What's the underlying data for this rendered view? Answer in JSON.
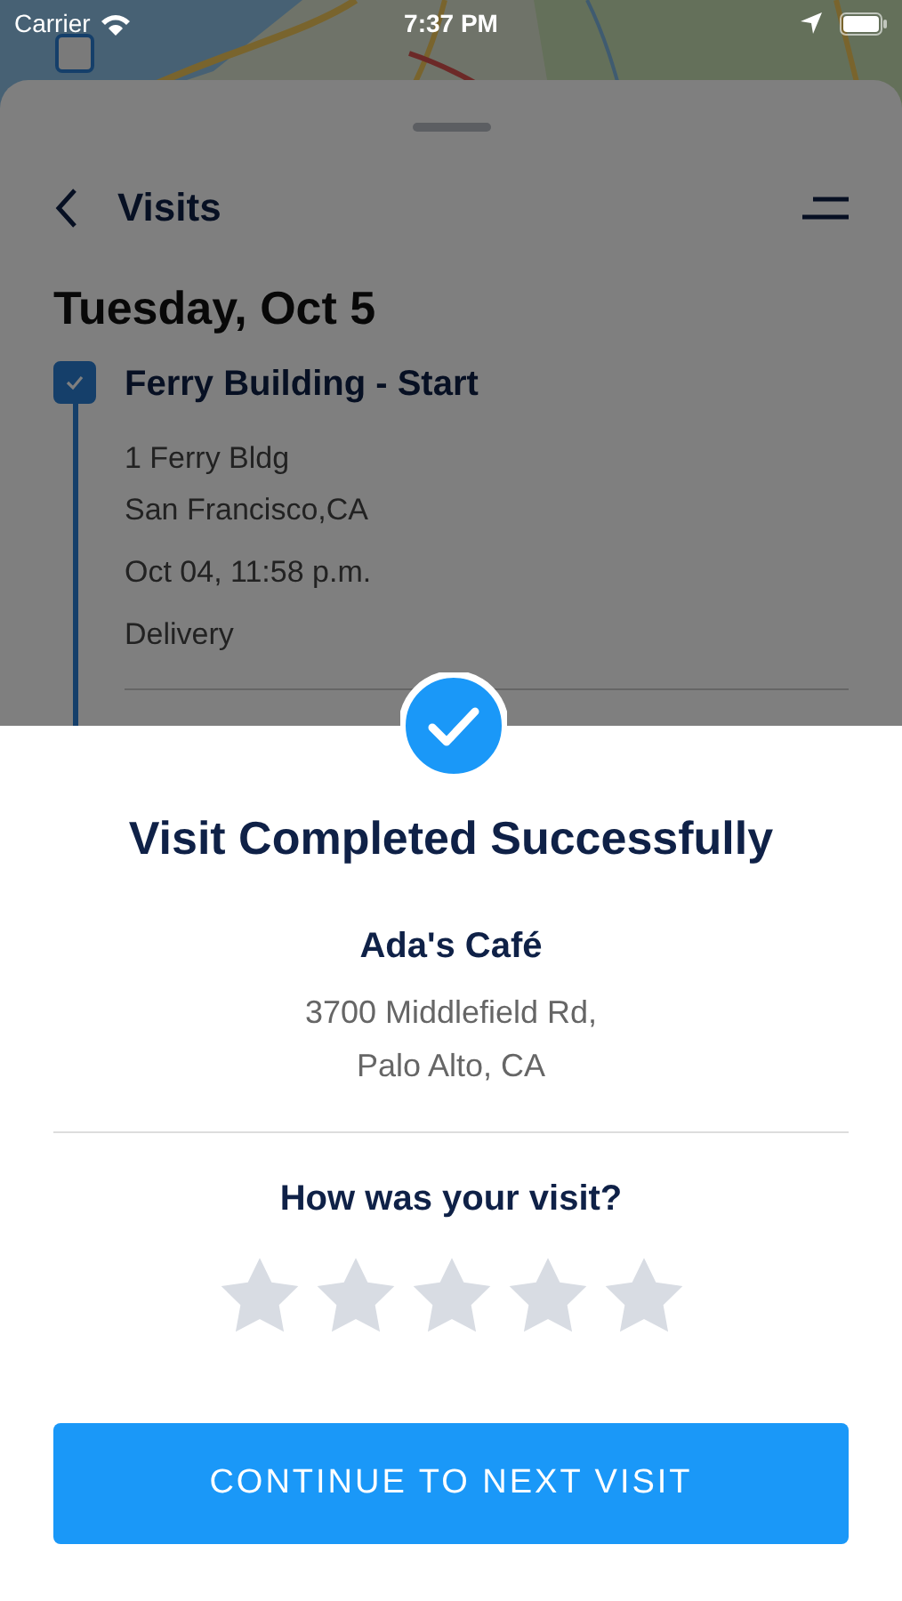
{
  "status_bar": {
    "carrier": "Carrier",
    "time": "7:37 PM"
  },
  "sheet": {
    "title": "Visits",
    "date": "Tuesday, Oct 5",
    "visits": [
      {
        "name": "Ferry Building - Start",
        "checked": true,
        "address_lines": [
          "1 Ferry Bldg",
          "San Francisco,CA"
        ],
        "time": "Oct 04, 11:58 p.m.",
        "type": "Delivery"
      }
    ]
  },
  "dialog": {
    "title": "Visit Completed Successfully",
    "place": "Ada's Café",
    "address_lines": [
      "3700 Middlefield Rd,",
      "Palo Alto, CA"
    ],
    "question": "How was your visit?",
    "stars": 0,
    "button": "CONTINUE TO NEXT VISIT"
  }
}
